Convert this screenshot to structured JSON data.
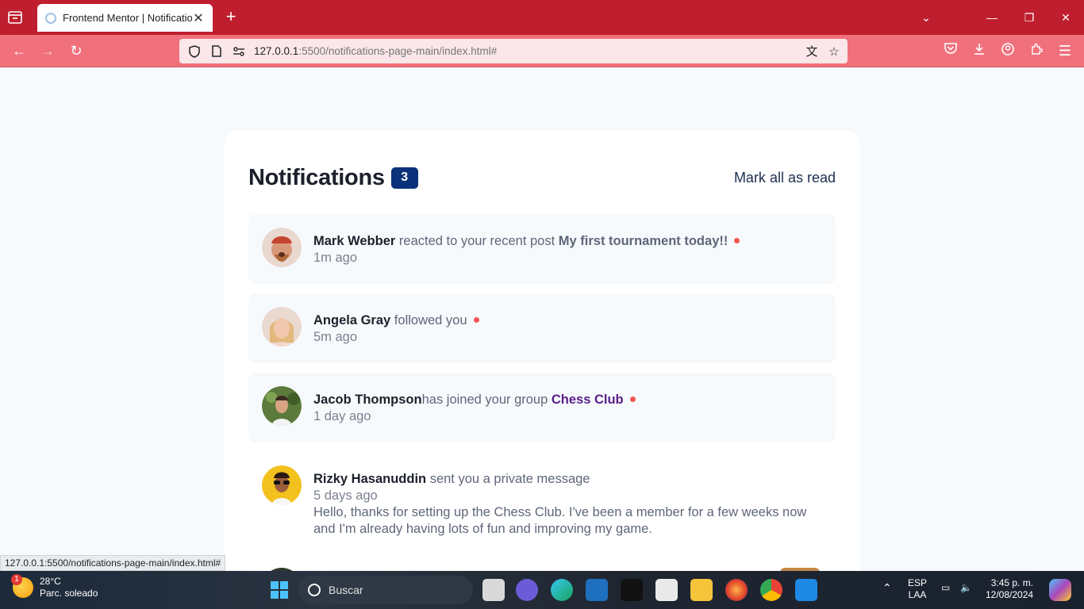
{
  "browser": {
    "tab_title": "Frontend Mentor | Notifications page",
    "url_host": "127.0.0.1",
    "url_path": ":5500/notifications-page-main/index.html#",
    "status_url": "127.0.0.1:5500/notifications-page-main/index.html#"
  },
  "header": {
    "title": "Notifications",
    "unread_count": "3",
    "mark_all": "Mark all as read"
  },
  "notifications": [
    {
      "name": "Mark Webber",
      "action": " reacted to your recent post ",
      "target": "My first tournament today!!",
      "time": "1m ago",
      "unread": true
    },
    {
      "name": "Angela Gray",
      "action": " followed you",
      "target": "",
      "time": "5m ago",
      "unread": true
    },
    {
      "name": "Jacob Thompson",
      "action": "has joined your group ",
      "target": "Chess Club",
      "time": "1 day ago",
      "unread": true
    },
    {
      "name": "Rizky Hasanuddin",
      "action": " sent you a private message",
      "target": "",
      "time": "5 days ago",
      "message": "Hello, thanks for setting up the Chess Club. I've been a member for a few weeks now and I'm already having lots of fun and improving my game.",
      "unread": false
    }
  ],
  "taskbar": {
    "temperature": "28°C",
    "weather_desc": "Parc. soleado",
    "weather_badge": "1",
    "search_placeholder": "Buscar",
    "lang_top": "ESP",
    "lang_bottom": "LAA",
    "time": "3:45 p. m.",
    "date": "12/08/2024"
  },
  "colors": {
    "tab_bar": "#bf1e2e",
    "nav_bar": "#f0707c",
    "badge_blue": "#0a327b",
    "unread_dot": "#f65552"
  }
}
